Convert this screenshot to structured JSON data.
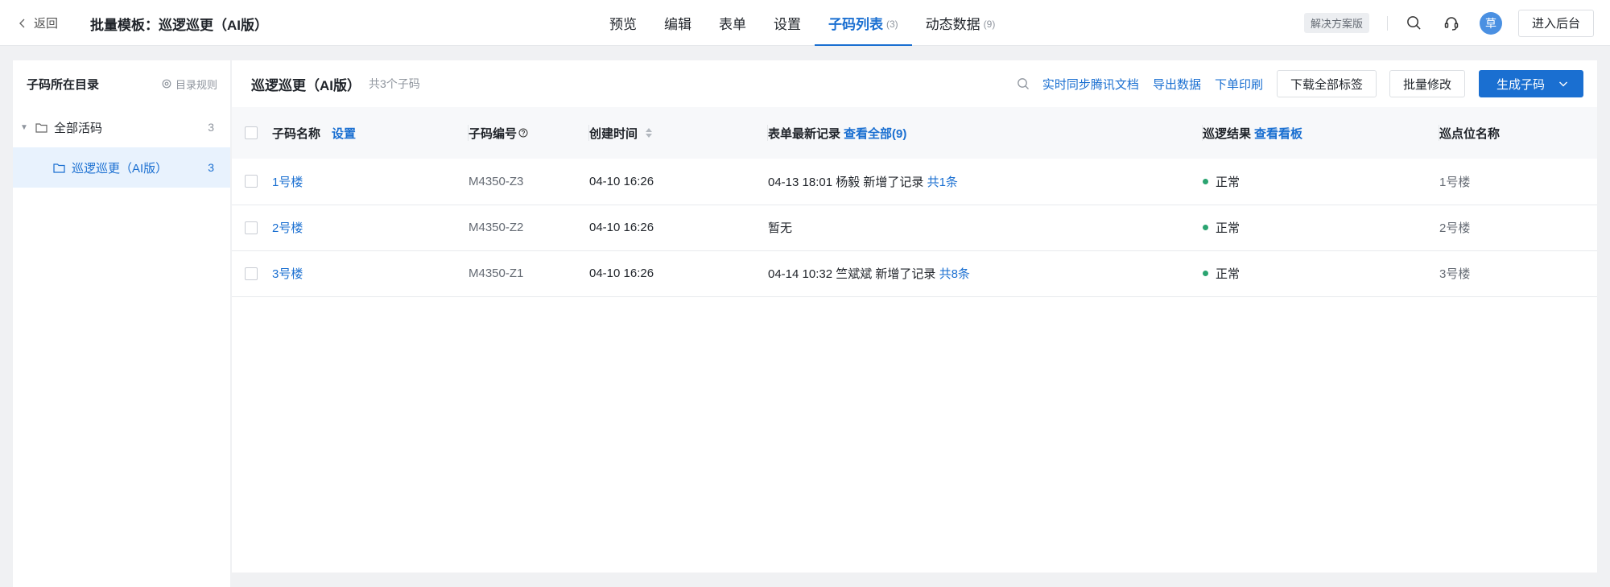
{
  "topbar": {
    "back_label": "返回",
    "page_title": "批量模板：巡逻巡更（AI版）",
    "tabs": [
      {
        "label": "预览",
        "count": ""
      },
      {
        "label": "编辑",
        "count": ""
      },
      {
        "label": "表单",
        "count": ""
      },
      {
        "label": "设置",
        "count": ""
      },
      {
        "label": "子码列表",
        "count": "(3)",
        "active": true
      },
      {
        "label": "动态数据",
        "count": "(9)"
      }
    ],
    "solution_badge": "解决方案版",
    "avatar_text": "草",
    "enter_backend": "进入后台"
  },
  "sidebar": {
    "title": "子码所在目录",
    "dir_rule": "目录规则",
    "items": [
      {
        "label": "全部活码",
        "count": "3"
      },
      {
        "label": "巡逻巡更（AI版）",
        "count": "3",
        "selected": true
      }
    ]
  },
  "main": {
    "title": "巡逻巡更（AI版）",
    "count_text": "共3个子码",
    "actions": {
      "sync_doc": "实时同步腾讯文档",
      "export": "导出数据",
      "print": "下单印刷",
      "download_labels": "下载全部标签",
      "batch_edit": "批量修改",
      "generate": "生成子码"
    },
    "columns": {
      "name": "子码名称",
      "name_link": "设置",
      "code": "子码编号",
      "created": "创建时间",
      "record": "表单最新记录",
      "record_link": "查看全部(9)",
      "result": "巡逻结果",
      "result_link": "查看看板",
      "point": "巡点位名称"
    },
    "rows": [
      {
        "name": "1号楼",
        "code": "M4350-Z3",
        "created": "04-10 16:26",
        "record": "04-13 18:01 杨毅 新增了记录 ",
        "record_link": "共1条",
        "result": "正常",
        "point": "1号楼"
      },
      {
        "name": "2号楼",
        "code": "M4350-Z2",
        "created": "04-10 16:26",
        "record": "暂无",
        "record_link": "",
        "result": "正常",
        "point": "2号楼"
      },
      {
        "name": "3号楼",
        "code": "M4350-Z1",
        "created": "04-10 16:26",
        "record": "04-14 10:32 竺斌斌 新增了记录 ",
        "record_link": "共8条",
        "result": "正常",
        "point": "3号楼"
      }
    ]
  },
  "colors": {
    "accent": "#1a6fd1",
    "status_ok": "#2ba471"
  }
}
